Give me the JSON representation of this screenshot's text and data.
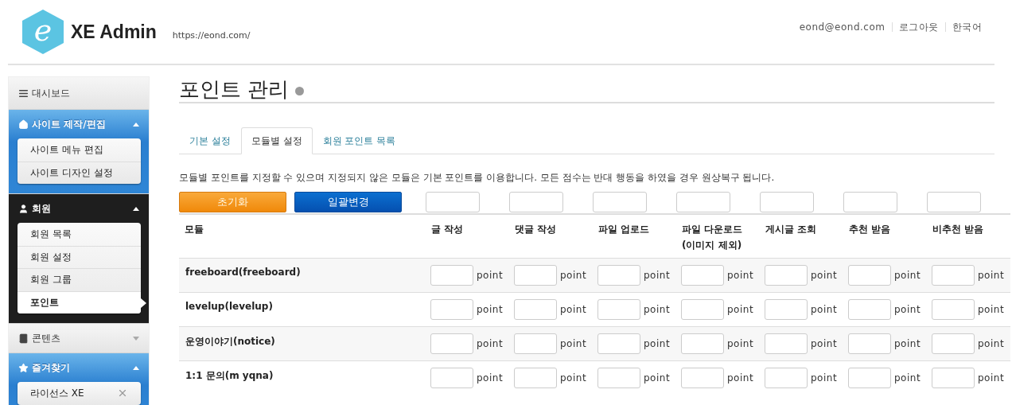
{
  "header": {
    "logo_letter": "e",
    "title": "XE Admin",
    "url": "https://eond.com/",
    "user_links": [
      {
        "label": "eond@eond.com"
      },
      {
        "label": "로그아웃"
      },
      {
        "label": "한국어"
      }
    ]
  },
  "sidebar": {
    "groups": [
      {
        "label": "대시보드",
        "kind": "link"
      },
      {
        "label": "사이트 제작/편집",
        "kind": "blue",
        "expanded": true,
        "items": [
          {
            "label": "사이트 메뉴 편집",
            "selected": false
          },
          {
            "label": "사이트 디자인 설정",
            "selected": false
          }
        ]
      },
      {
        "label": "회원",
        "kind": "dark",
        "expanded": true,
        "items": [
          {
            "label": "회원 목록",
            "selected": false
          },
          {
            "label": "회원 설정",
            "selected": false
          },
          {
            "label": "회원 그룹",
            "selected": false
          },
          {
            "label": "포인트",
            "selected": true
          }
        ]
      },
      {
        "label": "콘텐츠",
        "kind": "plain",
        "expanded": false
      },
      {
        "label": "즐겨찾기",
        "kind": "blue",
        "expanded": true,
        "items": [
          {
            "label": "라이선스 XE",
            "selected": false,
            "removable": true
          }
        ]
      }
    ]
  },
  "page": {
    "title": "포인트 관리",
    "tabs": [
      {
        "label": "기본 설정",
        "selected": false
      },
      {
        "label": "모듈별 설정",
        "selected": true
      },
      {
        "label": "회원 포인트 목록",
        "selected": false
      }
    ],
    "description": "모듈별 포인트를 지정할 수 있으며 지정되지 않은 모듈은 기본 포인트를 이용합니다. 모든 점수는 반대 행동을 하였을 경우 원상복구 됩니다.",
    "buttons": [
      {
        "label": "초기화",
        "kind": "reset"
      },
      {
        "label": "일괄변경",
        "kind": "apply"
      }
    ],
    "table": {
      "columns": [
        "모듈",
        "글 작성",
        "댓글 작성",
        "파일 업로드",
        "파일 다운로드 (이미지 제외)",
        "게시글 조회",
        "추천 받음",
        "비추천 받음"
      ],
      "rows": [
        {
          "module": "freeboard(freeboard)",
          "units": [
            "point",
            "point",
            "point",
            "point",
            "point",
            "point",
            "point"
          ]
        },
        {
          "module": "levelup(levelup)",
          "units": [
            "point",
            "point",
            "point",
            "point",
            "point",
            "point",
            "point"
          ]
        },
        {
          "module": "운영이야기(notice)",
          "units": [
            "point",
            "point",
            "point",
            "point",
            "point",
            "point",
            "point"
          ]
        },
        {
          "module": "1:1 문의(m yqna)",
          "units": [
            "point",
            "point",
            "point",
            "point",
            "point",
            "point",
            "point"
          ]
        }
      ]
    }
  }
}
